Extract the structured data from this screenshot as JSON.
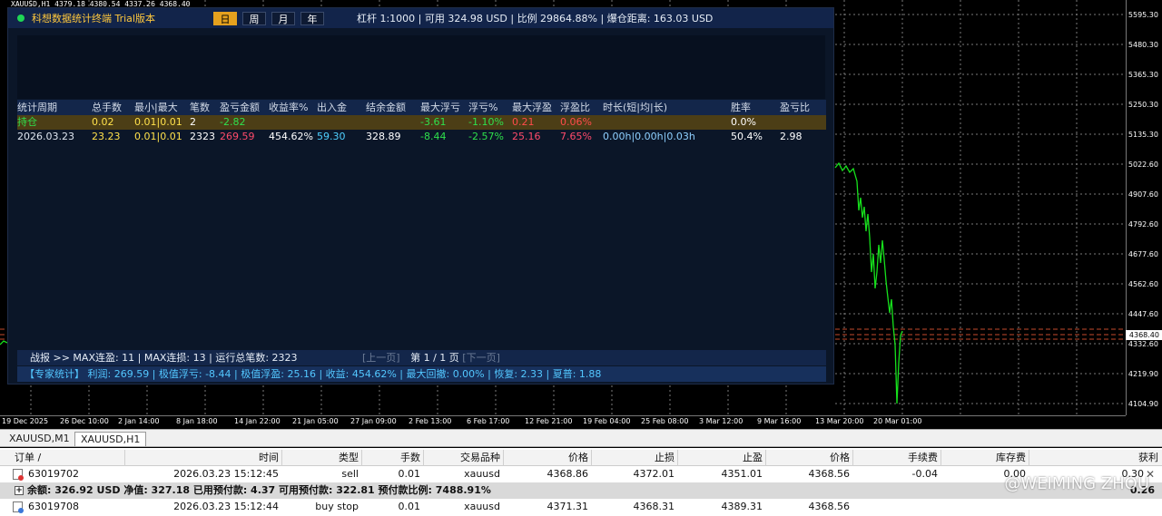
{
  "chart": {
    "symbol_header": "XAUUSD,H1  4379.18 4380.54 4337.26 4368.40",
    "price_labels": [
      "5595.30",
      "5480.30",
      "5365.30",
      "5250.30",
      "5135.30",
      "5022.60",
      "4907.60",
      "4792.60",
      "4677.60",
      "4562.60",
      "4447.60",
      "4332.60",
      "4219.90",
      "4104.90"
    ],
    "current_price": "4368.40",
    "time_labels": [
      "19 Dec 2025",
      "26 Dec 10:00",
      "2 Jan 14:00",
      "8 Jan 18:00",
      "14 Jan 22:00",
      "21 Jan 05:00",
      "27 Jan 09:00",
      "2 Feb 13:00",
      "6 Feb 17:00",
      "12 Feb 21:00",
      "19 Feb 04:00",
      "25 Feb 08:00",
      "3 Mar 12:00",
      "9 Mar 16:00",
      "13 Mar 20:00",
      "20 Mar 01:00"
    ],
    "line_color": "#16e01c"
  },
  "panel": {
    "title": "科想数据统计终端 Trial版本",
    "periods": [
      "日",
      "周",
      "月",
      "年"
    ],
    "active_period": "日",
    "account_info": "杠杆 1:1000 | 可用 324.98 USD | 比例 29864.88% | 爆仓距离: 163.03 USD",
    "columns": [
      "统计周期",
      "总手数",
      "最小|最大",
      "笔数",
      "盈亏金额",
      "收益率%",
      "出入金",
      "结余金额",
      "最大浮亏",
      "浮亏%",
      "最大浮盈",
      "浮盈比",
      "时长(短|均|长)",
      "胜率",
      "盈亏比"
    ],
    "rows": [
      {
        "period": "持仓",
        "lots": "0.02",
        "minmax": "0.01|0.01",
        "count": "2",
        "pnl": "-2.82",
        "ret": "",
        "flow": "",
        "balance": "",
        "max_dd": "-3.61",
        "dd_pct": "-1.10%",
        "max_fp": "0.21",
        "fp_ratio": "0.06%",
        "duration": "",
        "winrate": "0.0%",
        "pl_ratio": ""
      },
      {
        "period": "2026.03.23",
        "lots": "23.23",
        "minmax": "0.01|0.01",
        "count": "2323",
        "pnl": "269.59",
        "ret": "454.62%",
        "flow": "59.30",
        "balance": "328.89",
        "max_dd": "-8.44",
        "dd_pct": "-2.57%",
        "max_fp": "25.16",
        "fp_ratio": "7.65%",
        "duration": "0.00h|0.00h|0.03h",
        "winrate": "50.4%",
        "pl_ratio": "2.98"
      }
    ],
    "footer_stats": "战报 >> MAX连盈: 11 | MAX连损: 13 | 运行总笔数: 2323",
    "pager_prev": "[上一页]",
    "pager_current": "第 1 / 1 页",
    "pager_next": "[下一页]",
    "summary": "【专家统计】 利润: 269.59 | 极值浮亏: -8.44 | 极值浮盈: 25.16 | 收益: 454.62% | 最大回撤: 0.00% | 恢复: 2.33 | 夏普: 1.88"
  },
  "tabs": [
    "XAUUSD,M1",
    "XAUUSD,H1"
  ],
  "active_tab": "XAUUSD,H1",
  "terminal": {
    "columns": [
      "订单 /",
      "时间",
      "类型",
      "手数",
      "交易品种",
      "价格",
      "止损",
      "止盈",
      "价格",
      "手续费",
      "库存费",
      "获利"
    ],
    "orders": [
      {
        "id": "63019702",
        "time": "2026.03.23 15:12:45",
        "type": "sell",
        "lots": "0.01",
        "symbol": "xauusd",
        "price": "4368.86",
        "sl": "4372.01",
        "tp": "4351.01",
        "cur_price": "4368.56",
        "commission": "-0.04",
        "swap": "0.00",
        "profit": "0.30"
      },
      {
        "id": "63019708",
        "time": "2026.03.23 15:12:44",
        "type": "buy stop",
        "lots": "0.01",
        "symbol": "xauusd",
        "price": "4371.31",
        "sl": "4368.31",
        "tp": "4389.31",
        "cur_price": "4368.56",
        "commission": "",
        "swap": "",
        "profit": ""
      }
    ],
    "balance_line": "余额: 326.92 USD  净值: 327.18  已用预付款: 4.37  可用预付款: 322.81  预付款比例: 7488.91%",
    "balance_profit": "0.26"
  },
  "watermark": "@WEIMING ZHOU"
}
